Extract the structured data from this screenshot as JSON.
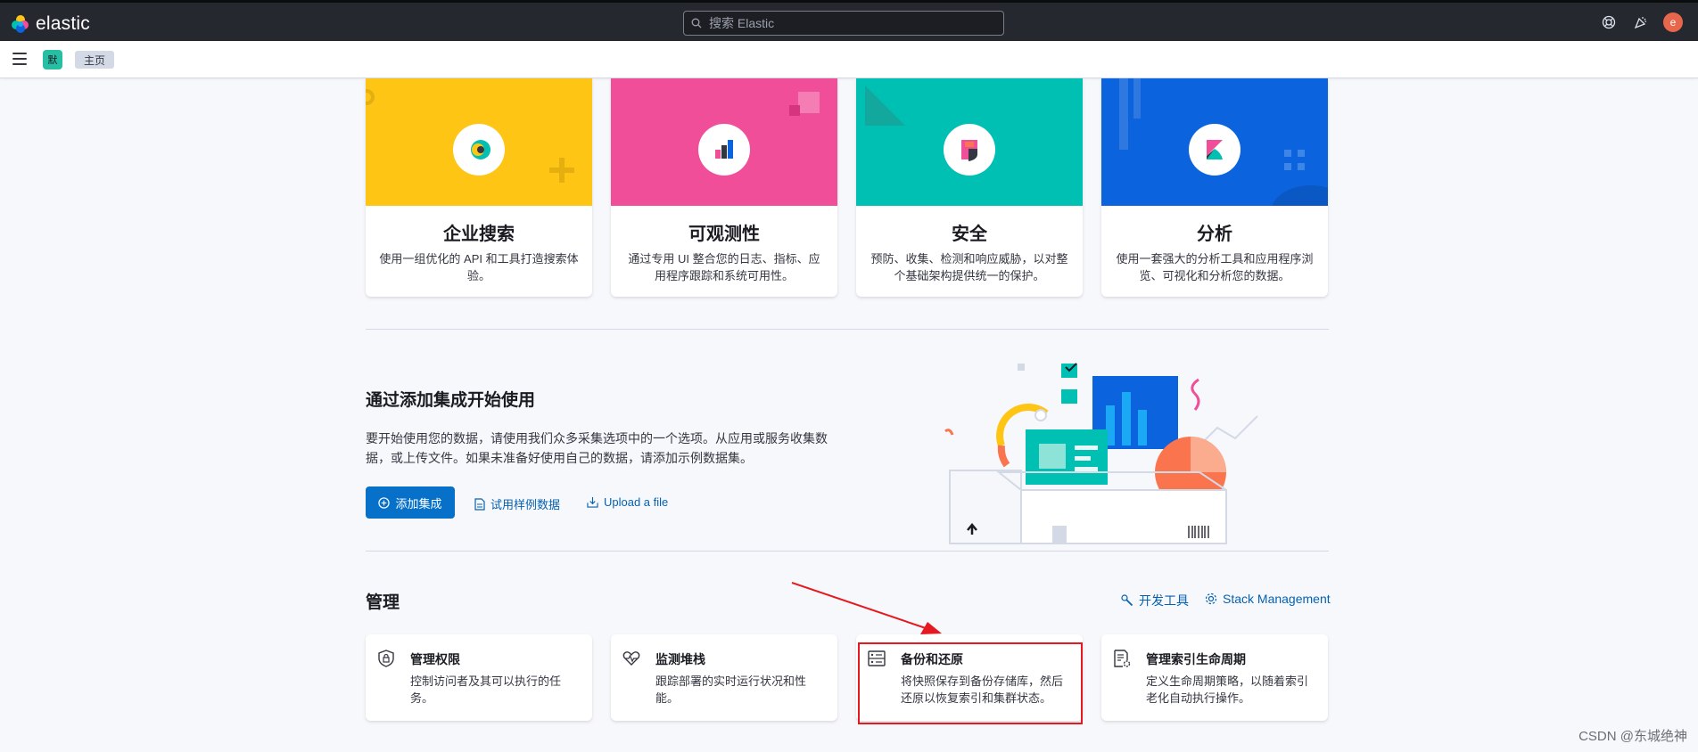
{
  "header": {
    "brand": "elastic",
    "search_placeholder": "搜索 Elastic",
    "avatar_letter": "e"
  },
  "subbar": {
    "space_badge": "默",
    "breadcrumb": "主页"
  },
  "solutions": [
    {
      "title": "企业搜索",
      "desc": "使用一组优化的 API 和工具打造搜索体验。",
      "color": "#fec514"
    },
    {
      "title": "可观测性",
      "desc": "通过专用 UI 整合您的日志、指标、应用程序跟踪和系统可用性。",
      "color": "#f04e98"
    },
    {
      "title": "安全",
      "desc": "预防、收集、检测和响应威胁，以对整个基础架构提供统一的保护。",
      "color": "#00bfb3"
    },
    {
      "title": "分析",
      "desc": "使用一套强大的分析工具和应用程序浏览、可视化和分析您的数据。",
      "color": "#0b64dd"
    }
  ],
  "integrations": {
    "title": "通过添加集成开始使用",
    "desc": "要开始使用您的数据，请使用我们众多采集选项中的一个选项。从应用或服务收集数据，或上传文件。如果未准备好使用自己的数据，请添加示例数据集。",
    "add_button": "添加集成",
    "sample_link": "试用样例数据",
    "upload_link": "Upload a file"
  },
  "management": {
    "title": "管理",
    "dev_tools": "开发工具",
    "stack_management": "Stack Management",
    "cards": [
      {
        "title": "管理权限",
        "desc": "控制访问者及其可以执行的任务。",
        "icon": "shield-lock-icon"
      },
      {
        "title": "监测堆栈",
        "desc": "跟踪部署的实时运行状况和性能。",
        "icon": "heartbeat-icon"
      },
      {
        "title": "备份和还原",
        "desc": "将快照保存到备份存储库，然后还原以恢复索引和集群状态。",
        "icon": "storage-icon"
      },
      {
        "title": "管理索引生命周期",
        "desc": "定义生命周期策略，以随着索引老化自动执行操作。",
        "icon": "index-settings-icon"
      }
    ]
  },
  "watermark": "CSDN @东城绝神"
}
